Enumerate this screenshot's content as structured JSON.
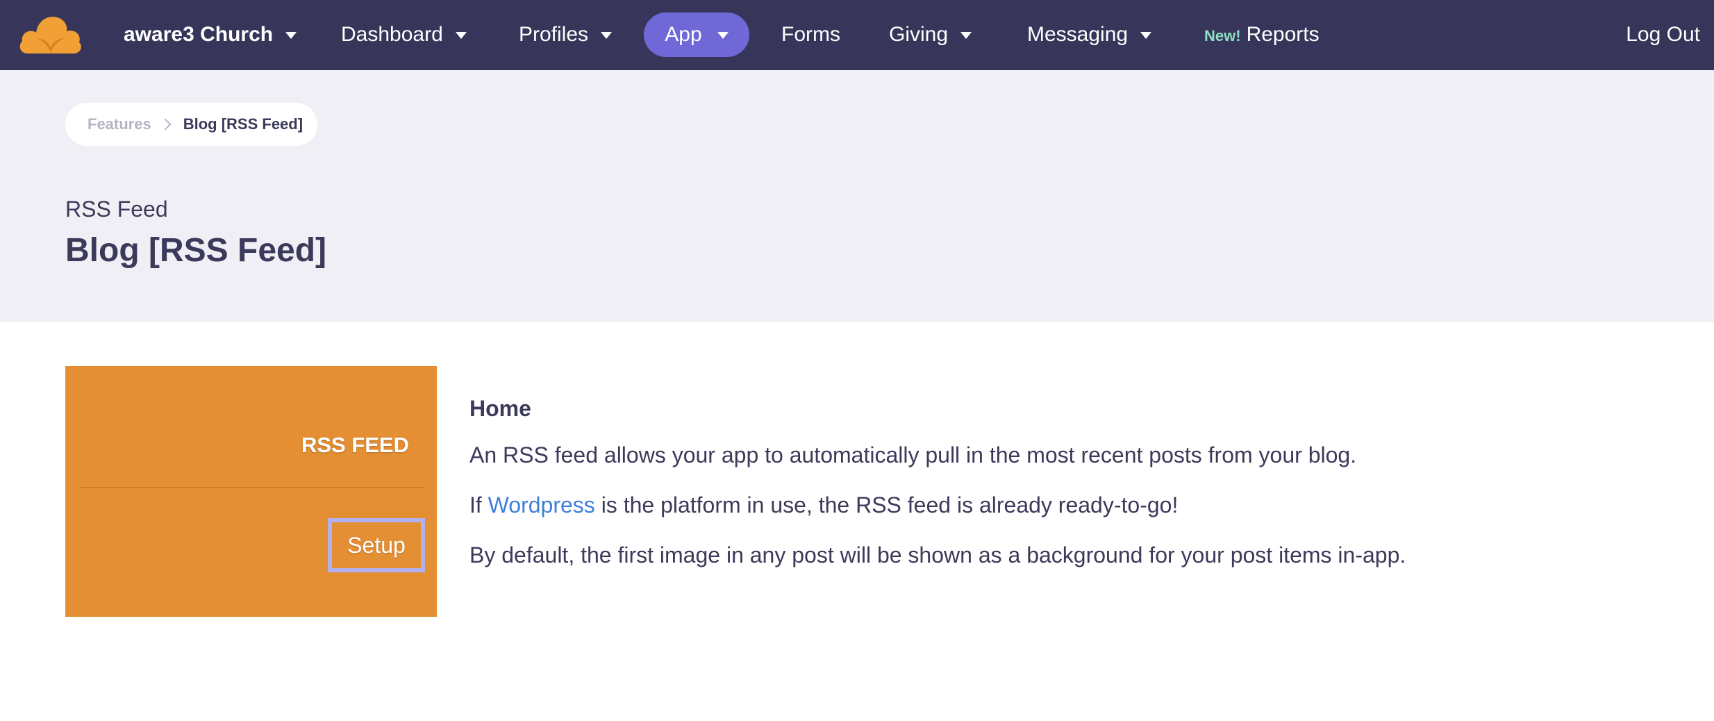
{
  "nav": {
    "org": "aware3 Church",
    "dashboard": "Dashboard",
    "profiles": "Profiles",
    "app": "App",
    "forms": "Forms",
    "giving": "Giving",
    "messaging": "Messaging",
    "new_badge": "New!",
    "reports": "Reports",
    "logout": "Log Out"
  },
  "breadcrumb": {
    "features": "Features",
    "current": "Blog [RSS Feed]"
  },
  "header": {
    "subtitle": "RSS Feed",
    "title": "Blog [RSS Feed]"
  },
  "card": {
    "label": "RSS FEED",
    "setup": "Setup"
  },
  "description": {
    "heading": "Home",
    "para1": "An RSS feed allows your app to automatically pull in the most recent posts from your blog.",
    "para2_prefix": "If ",
    "para2_link": "Wordpress",
    "para2_suffix": " is the platform in use, the RSS feed is already ready-to-go!",
    "para3": "By default, the first image in any post will be shown as a background for your post items in-app."
  },
  "colors": {
    "navbar": "#37365a",
    "nav_active": "#6f68d6",
    "header_bg": "#f0eff5",
    "card_orange": "#e58f34",
    "setup_border": "#b3b0f2",
    "link": "#3f7fdc",
    "new_badge": "#8fe0c3"
  },
  "icons": {
    "logo": "aware3-cloud-logo",
    "caret": "caret-down-icon",
    "breadcrumb_sep": "chevron-right-icon"
  }
}
